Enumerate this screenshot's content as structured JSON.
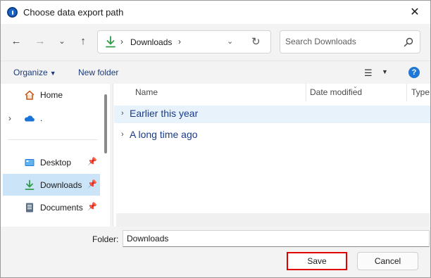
{
  "window": {
    "title": "Choose data export path",
    "close_label": "✕"
  },
  "address_bar": {
    "location": "Downloads",
    "separator": "›"
  },
  "search": {
    "placeholder": "Search Downloads"
  },
  "command_bar": {
    "organize_label": "Organize",
    "new_folder_label": "New folder",
    "help_label": "?"
  },
  "nav_pane": {
    "items": [
      {
        "label": "Home",
        "icon": "home-icon",
        "pinned": false
      },
      {
        "label": "",
        "icon": "onedrive-cloud-icon",
        "pinned": false
      },
      {
        "label": "Desktop",
        "icon": "desktop-icon",
        "pinned": true
      },
      {
        "label": "Downloads",
        "icon": "download-icon",
        "pinned": true,
        "selected": true
      },
      {
        "label": "Documents",
        "icon": "documents-icon",
        "pinned": true
      }
    ],
    "onedrive_suffix": "."
  },
  "file_list": {
    "columns": [
      "Name",
      "Date modified",
      "Type"
    ],
    "groups": [
      {
        "label": "Earlier this year",
        "selected": true
      },
      {
        "label": "A long time ago",
        "selected": false
      }
    ]
  },
  "footer": {
    "folder_label": "Folder:",
    "folder_value": "Downloads",
    "save_label": "Save",
    "cancel_label": "Cancel"
  },
  "colors": {
    "accent": "#1f78d7",
    "selected_bg": "#cce4f7",
    "highlight_border": "#e00000",
    "download_green": "#2e9b48"
  }
}
